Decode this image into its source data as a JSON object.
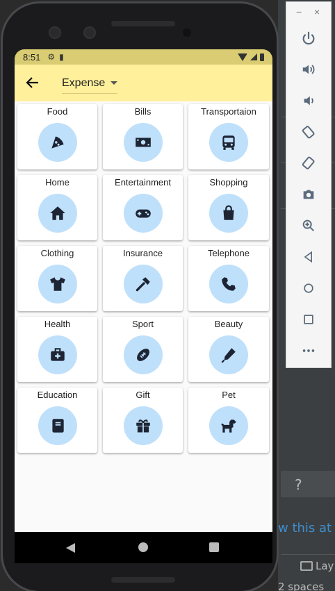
{
  "status": {
    "time": "8:51"
  },
  "appbar": {
    "dropdown_value": "Expense"
  },
  "categories": [
    {
      "label": "Food",
      "icon": "pizza-icon"
    },
    {
      "label": "Bills",
      "icon": "money-icon"
    },
    {
      "label": "Transportaion",
      "icon": "bus-icon"
    },
    {
      "label": "Home",
      "icon": "house-icon"
    },
    {
      "label": "Entertainment",
      "icon": "gamepad-icon"
    },
    {
      "label": "Shopping",
      "icon": "shopping-bag-icon"
    },
    {
      "label": "Clothing",
      "icon": "tshirt-icon"
    },
    {
      "label": "Insurance",
      "icon": "hammer-icon"
    },
    {
      "label": "Telephone",
      "icon": "phone-icon"
    },
    {
      "label": "Health",
      "icon": "medical-kit-icon"
    },
    {
      "label": "Sport",
      "icon": "football-icon"
    },
    {
      "label": "Beauty",
      "icon": "pen-icon"
    },
    {
      "label": "Education",
      "icon": "book-icon"
    },
    {
      "label": "Gift",
      "icon": "gift-icon"
    },
    {
      "label": "Pet",
      "icon": "dog-icon"
    }
  ],
  "ide": {
    "help_label": "?",
    "link_text": "w this at s",
    "layout_label": "Lay",
    "spaces_label": "2 spaces"
  },
  "emulator": {
    "minimize": "−",
    "close": "×"
  },
  "colors": {
    "appbar": "#fff09c",
    "statusbar": "#d9cc72",
    "icon_circle": "#bfe0fb",
    "icon": "#1d2433"
  }
}
